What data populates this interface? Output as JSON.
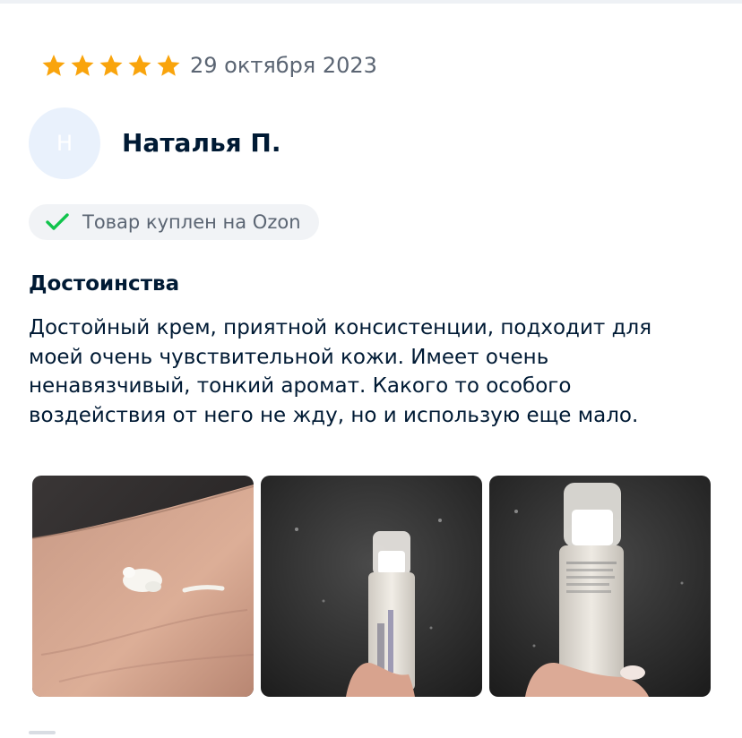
{
  "review": {
    "rating": 5,
    "date": "29 октября 2023",
    "avatar_letter": "Н",
    "author": "Наталья П.",
    "verified_badge": "Товар куплен на Ozon",
    "section_title": "Достоинства",
    "text_lines": [
      "Достойный крем, приятной консистенции, подходит для",
      "моей очень чувствительной кожи. Имеет очень",
      "ненавязчивый, тонкий аромат. Какого то особого",
      "воздействия от него не жду, но и использую еще мало."
    ],
    "photos": [
      {
        "name": "review-photo-hand-cream"
      },
      {
        "name": "review-photo-tube-front"
      },
      {
        "name": "review-photo-tube-back"
      }
    ]
  },
  "icons": {
    "star": "star-icon",
    "check": "checkmark-icon"
  },
  "colors": {
    "star": "#f9a40c",
    "check": "#10c44c",
    "text": "#001a34",
    "muted": "#5b6573",
    "badge_bg": "#f1f3f6",
    "avatar_bg": "#e9f1fc"
  }
}
